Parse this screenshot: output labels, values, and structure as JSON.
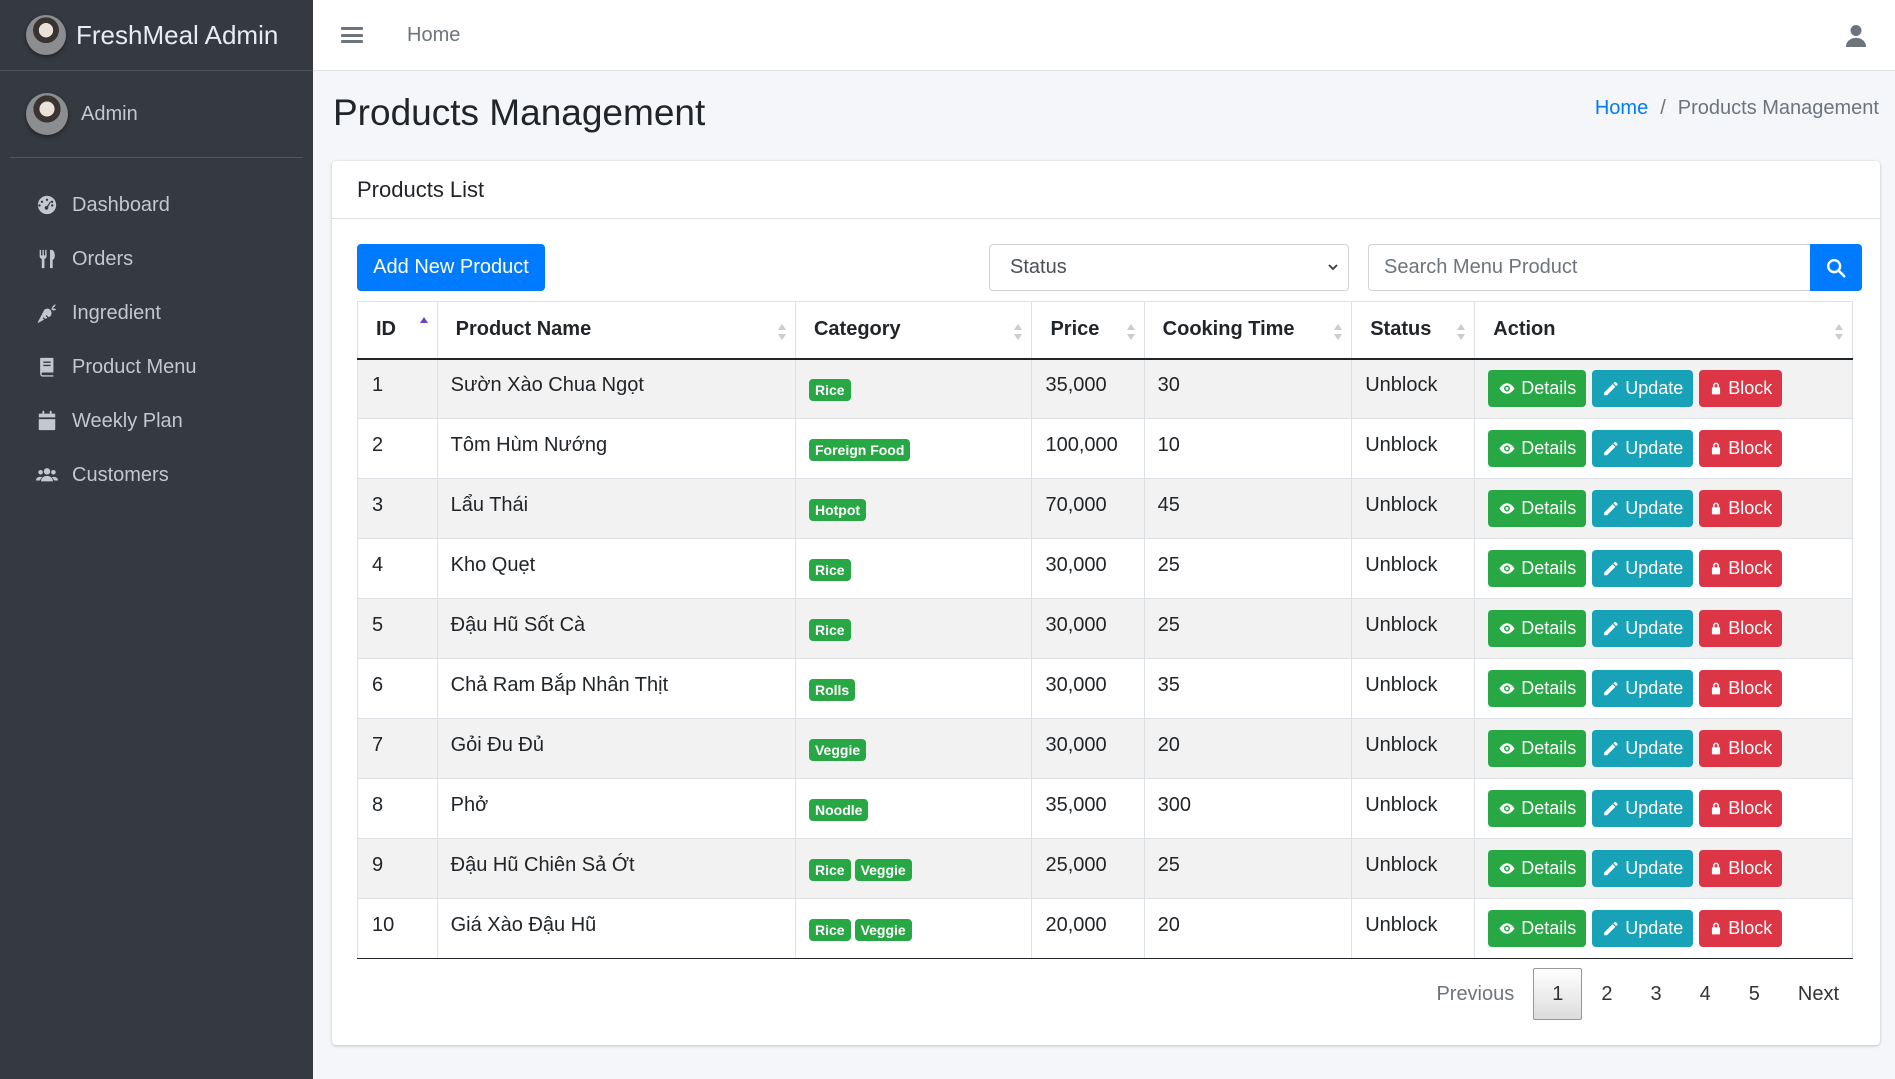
{
  "app": {
    "brand": "FreshMeal Admin",
    "user": "Admin"
  },
  "sidebar": {
    "items": [
      {
        "label": "Dashboard",
        "icon": "tachometer-icon"
      },
      {
        "label": "Orders",
        "icon": "utensils-icon"
      },
      {
        "label": "Ingredient",
        "icon": "carrot-icon"
      },
      {
        "label": "Product Menu",
        "icon": "book-icon"
      },
      {
        "label": "Weekly Plan",
        "icon": "calendar-icon"
      },
      {
        "label": "Customers",
        "icon": "users-icon"
      }
    ]
  },
  "topbar": {
    "home": "Home"
  },
  "page": {
    "title": "Products Management"
  },
  "breadcrumb": {
    "home": "Home",
    "sep": "/",
    "current": "Products Management"
  },
  "card": {
    "title": "Products List"
  },
  "toolbar": {
    "add_label": "Add New Product",
    "status_value": "Status",
    "search_placeholder": "Search Menu Product"
  },
  "table": {
    "headers": [
      "ID",
      "Product Name",
      "Category",
      "Price",
      "Cooking Time",
      "Status",
      "Action"
    ],
    "rows": [
      {
        "id": "1",
        "name": "Sườn Xào Chua Ngọt",
        "categories": [
          "Rice"
        ],
        "price": "35,000",
        "time": "30",
        "status": "Unblock"
      },
      {
        "id": "2",
        "name": "Tôm Hùm Nướng",
        "categories": [
          "Foreign Food"
        ],
        "price": "100,000",
        "time": "10",
        "status": "Unblock"
      },
      {
        "id": "3",
        "name": "Lẩu Thái",
        "categories": [
          "Hotpot"
        ],
        "price": "70,000",
        "time": "45",
        "status": "Unblock"
      },
      {
        "id": "4",
        "name": "Kho Quẹt",
        "categories": [
          "Rice"
        ],
        "price": "30,000",
        "time": "25",
        "status": "Unblock"
      },
      {
        "id": "5",
        "name": "Đậu Hũ Sốt Cà",
        "categories": [
          "Rice"
        ],
        "price": "30,000",
        "time": "25",
        "status": "Unblock"
      },
      {
        "id": "6",
        "name": "Chả Ram Bắp Nhân Thịt",
        "categories": [
          "Rolls"
        ],
        "price": "30,000",
        "time": "35",
        "status": "Unblock"
      },
      {
        "id": "7",
        "name": "Gỏi Đu Đủ",
        "categories": [
          "Veggie"
        ],
        "price": "30,000",
        "time": "20",
        "status": "Unblock"
      },
      {
        "id": "8",
        "name": "Phở",
        "categories": [
          "Noodle"
        ],
        "price": "35,000",
        "time": "300",
        "status": "Unblock"
      },
      {
        "id": "9",
        "name": "Đậu Hũ Chiên Sả Ớt",
        "categories": [
          "Rice",
          "Veggie"
        ],
        "price": "25,000",
        "time": "25",
        "status": "Unblock"
      },
      {
        "id": "10",
        "name": "Giá Xào Đậu Hũ",
        "categories": [
          "Rice",
          "Veggie"
        ],
        "price": "20,000",
        "time": "20",
        "status": "Unblock"
      }
    ],
    "actions": {
      "details": "Details",
      "update": "Update",
      "block": "Block"
    }
  },
  "pagination": {
    "previous": "Previous",
    "pages": [
      "1",
      "2",
      "3",
      "4",
      "5"
    ],
    "current": "1",
    "next": "Next"
  },
  "colors": {
    "primary": "#007bff",
    "success": "#28a745",
    "info": "#17a2b8",
    "danger": "#dc3545",
    "sidebar": "#343a40"
  }
}
